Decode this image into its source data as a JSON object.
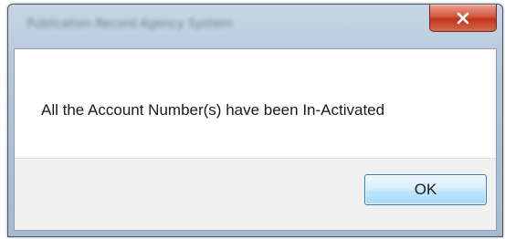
{
  "window": {
    "title": "Publication Record Agency System"
  },
  "message": {
    "text": "All the Account Number(s) have been In-Activated"
  },
  "buttons": {
    "ok_label": "OK"
  },
  "icons": {
    "close": "close-icon"
  },
  "colors": {
    "close_button": "#c7462b",
    "ok_button_border": "#3c7fb1",
    "footer_bg": "#f0f0f0",
    "frame": "#b3c6da"
  }
}
